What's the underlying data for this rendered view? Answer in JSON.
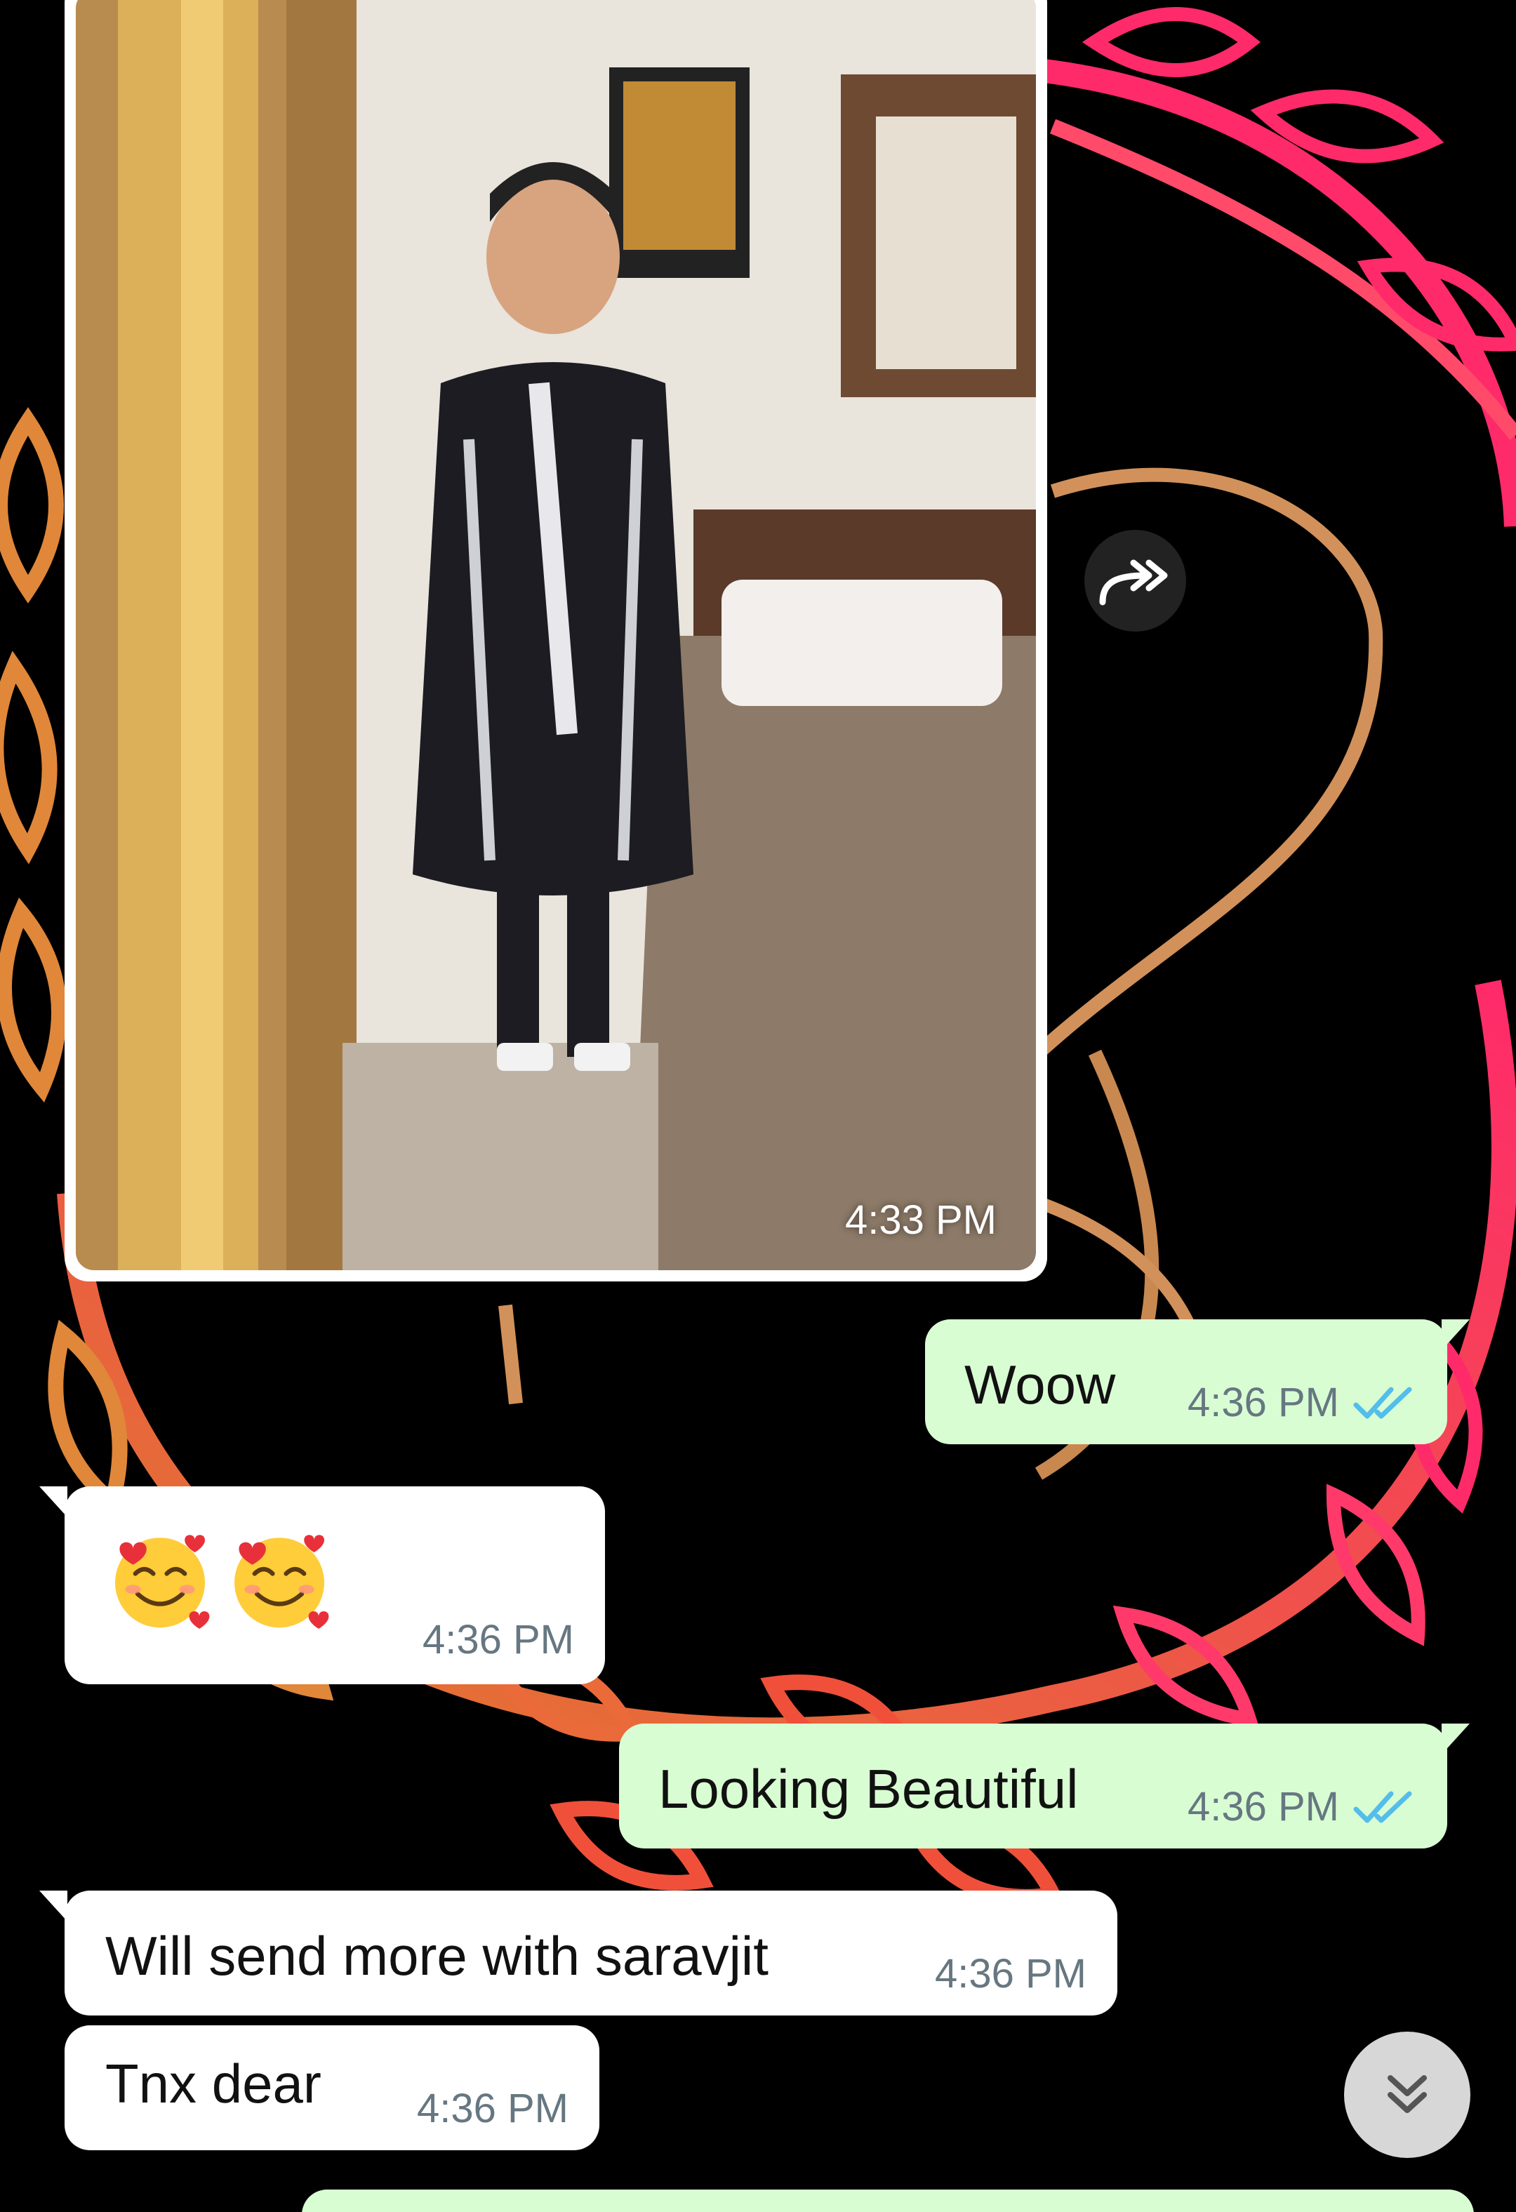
{
  "image_message": {
    "time": "4:33 PM"
  },
  "messages": [
    {
      "id": "woow",
      "direction": "outgoing",
      "text": "Woow",
      "time": "4:36 PM",
      "status": "read"
    },
    {
      "id": "emoji",
      "direction": "incoming",
      "text": "🥰🥰",
      "time": "4:36 PM"
    },
    {
      "id": "beautiful",
      "direction": "outgoing",
      "text": "Looking Beautiful",
      "time": "4:36 PM",
      "status": "read"
    },
    {
      "id": "send-more",
      "direction": "incoming",
      "text": "Will send more with saravjit",
      "time": "4:36 PM"
    },
    {
      "id": "tnx",
      "direction": "incoming",
      "text": "Tnx dear",
      "time": "4:36 PM"
    }
  ],
  "icons": {
    "forward": "forward-icon",
    "read_receipt": "double-check-icon",
    "scroll_down": "chevron-double-down-icon"
  },
  "colors": {
    "outgoing_bubble": "#d9fdd3",
    "incoming_bubble": "#ffffff",
    "read_tick": "#53bdeb",
    "meta_text": "#667781",
    "wallpaper_bg": "#000000"
  }
}
